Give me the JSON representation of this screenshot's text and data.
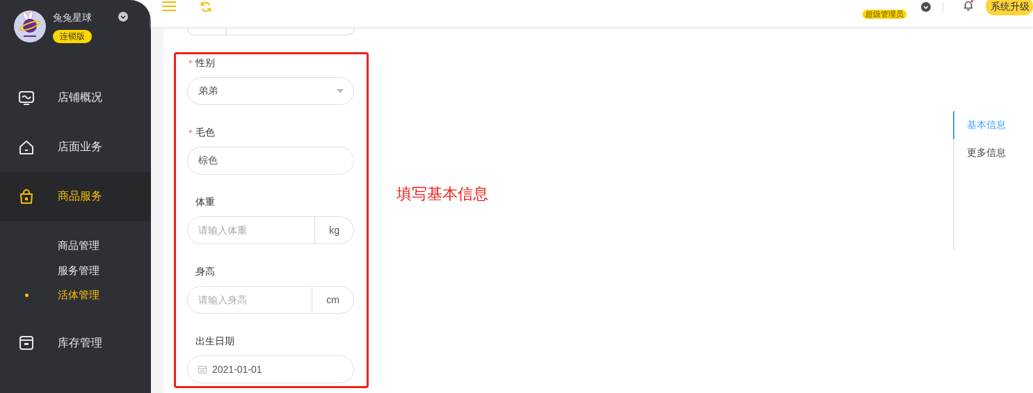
{
  "sidebar": {
    "shop_name": "兔兔星球",
    "edition_badge": "连锁版",
    "menu": [
      {
        "label": "店铺概况",
        "selected": false
      },
      {
        "label": "店面业务",
        "selected": false
      },
      {
        "label": "商品服务",
        "selected": true,
        "children": [
          {
            "label": "商品管理",
            "selected": false
          },
          {
            "label": "服务管理",
            "selected": false
          },
          {
            "label": "活体管理",
            "selected": true
          }
        ]
      },
      {
        "label": "库存管理",
        "selected": false
      }
    ]
  },
  "header": {
    "role_badge": "超级管理员",
    "has_unread_notifications": true,
    "upgrade_button": "系统升级"
  },
  "form": {
    "required_mark": "*",
    "fields": [
      {
        "kind": "select",
        "label": "性别",
        "required": true,
        "value": "弟弟"
      },
      {
        "kind": "text",
        "label": "毛色",
        "required": true,
        "value": "棕色"
      },
      {
        "kind": "unit",
        "label": "体重",
        "required": false,
        "placeholder": "请输入体重",
        "unit": "kg"
      },
      {
        "kind": "unit",
        "label": "身高",
        "required": false,
        "placeholder": "请输入身高",
        "unit": "cm"
      },
      {
        "kind": "date",
        "label": "出生日期",
        "required": false,
        "value": "2021-01-01"
      }
    ]
  },
  "annotation": "填写基本信息",
  "anchor_nav": [
    {
      "label": "基本信息",
      "selected": true
    },
    {
      "label": "更多信息",
      "selected": false
    }
  ]
}
